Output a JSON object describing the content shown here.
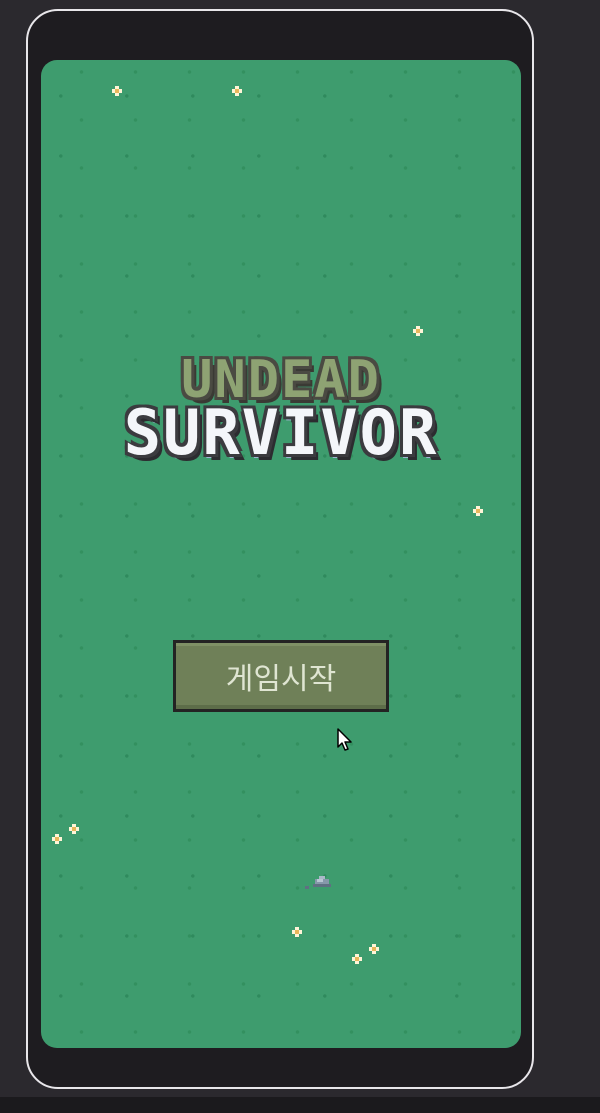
{
  "game": {
    "title_line1": "UNDEAD",
    "title_line2": "SURVIVOR",
    "start_button_label": "게임시작"
  },
  "icons": {
    "flower": "flower-icon",
    "rock": "rock-icon",
    "cursor": "mouse-cursor-icon"
  },
  "colors": {
    "grass": "#3e9c6e",
    "button": "#6f8058",
    "button_text": "#dfe5d2",
    "title_top": "#8ea373",
    "title_bottom": "#f4f6fa"
  }
}
